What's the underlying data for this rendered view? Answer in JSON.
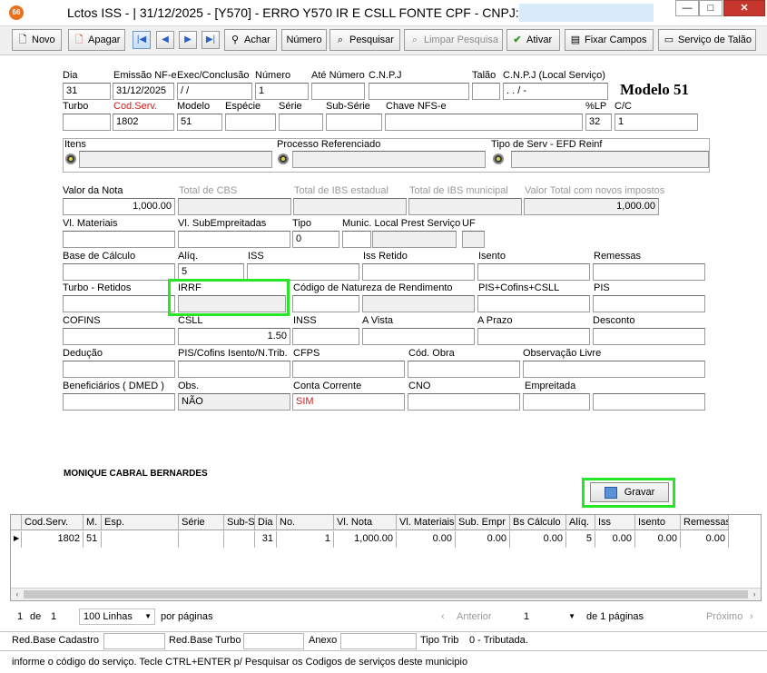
{
  "window": {
    "app_icon_text": "66",
    "title": "Lctos ISS - |  31/12/2025 - [Y570] - ERRO Y570 IR E CSLL FONTE CPF - CNPJ:",
    "cnpj_value": "",
    "minimize": "—",
    "maximize": "□",
    "close": "✕"
  },
  "toolbar": {
    "novo": "Novo",
    "apagar": "Apagar",
    "first": "|◀",
    "prev": "◀",
    "next": "▶",
    "last": "▶|",
    "achar": "Achar",
    "numero": "Número",
    "pesquisar": "Pesquisar",
    "limpar_pesquisa": "Limpar Pesquisa",
    "ativar": "Ativar",
    "fixar_campos": "Fixar Campos",
    "servico_talao": "Serviço de Talão"
  },
  "form": {
    "modelo_title": "Modelo 51",
    "dia": {
      "label": "Dia",
      "value": "31"
    },
    "emissao": {
      "label": "Emissão NF-e",
      "value": "31/12/2025"
    },
    "exec": {
      "label": "Exec/Conclusão",
      "value": " / /"
    },
    "numero": {
      "label": "Número",
      "value": "1"
    },
    "ate_numero": {
      "label": "Até Número",
      "value": ""
    },
    "cnpj": {
      "label": "C.N.P.J",
      "value": ""
    },
    "talao": {
      "label": "Talão",
      "value": ""
    },
    "cnpj_local": {
      "label": "C.N.P.J (Local Serviço)",
      "value": " .  .  /  -"
    },
    "turbo": {
      "label": "Turbo",
      "value": ""
    },
    "cod_serv": {
      "label": "Cod.Serv.",
      "value": "1802"
    },
    "modelo": {
      "label": "Modelo",
      "value": "51"
    },
    "especie": {
      "label": "Espécie",
      "value": ""
    },
    "serie": {
      "label": "Série",
      "value": ""
    },
    "sub_serie": {
      "label": "Sub-Série",
      "value": ""
    },
    "chave_nfse": {
      "label": "Chave NFS-e",
      "value": ""
    },
    "pct_lp": {
      "label": "%LP",
      "value": "32"
    },
    "cc": {
      "label": "C/C",
      "value": "1"
    },
    "itens": {
      "label": "Itens",
      "value": ""
    },
    "processo_ref": {
      "label": "Processo Referenciado",
      "value": ""
    },
    "tipo_serv": {
      "label": "Tipo de Serv - EFD Reinf",
      "value": ""
    },
    "valor_nota": {
      "label": "Valor da Nota",
      "value": "1,000.00"
    },
    "total_cbs": {
      "label": "Total de CBS",
      "value": ""
    },
    "total_ibs_est": {
      "label": "Total de IBS estadual",
      "value": ""
    },
    "total_ibs_mun": {
      "label": "Total de IBS municipal",
      "value": ""
    },
    "valor_total_novos": {
      "label": "Valor Total com novos impostos",
      "value": "1,000.00"
    },
    "vl_materiais": {
      "label": "Vl. Materiais",
      "value": ""
    },
    "vl_subempreitadas": {
      "label": "Vl. SubEmpreitadas",
      "value": ""
    },
    "tipo": {
      "label": "Tipo",
      "value": "0"
    },
    "munic": {
      "label": "Munic. Local Prest Serviço",
      "value": ""
    },
    "uf": {
      "label": "UF",
      "value": ""
    },
    "base_calculo": {
      "label": "Base de Cálculo",
      "value": ""
    },
    "aliq": {
      "label": "Alíq.",
      "value": "5"
    },
    "iss": {
      "label": "ISS",
      "value": ""
    },
    "iss_retido": {
      "label": "Iss Retido",
      "value": ""
    },
    "isento": {
      "label": "Isento",
      "value": ""
    },
    "remessas": {
      "label": "Remessas",
      "value": ""
    },
    "turbo_retidos": {
      "label": "Turbo - Retidos",
      "value": ""
    },
    "irrf": {
      "label": "IRRF",
      "value": ""
    },
    "cod_natureza": {
      "label": "Código de Natureza de Rendimento",
      "value": ""
    },
    "pis_cofins_csll": {
      "label": "PIS+Cofins+CSLL",
      "value": ""
    },
    "pis": {
      "label": "PIS",
      "value": ""
    },
    "cofins": {
      "label": "COFINS",
      "value": ""
    },
    "csll": {
      "label": "CSLL",
      "value": "1.50"
    },
    "inss": {
      "label": "INSS",
      "value": ""
    },
    "a_vista": {
      "label": "A Vista",
      "value": ""
    },
    "a_prazo": {
      "label": "A Prazo",
      "value": ""
    },
    "desconto": {
      "label": "Desconto",
      "value": ""
    },
    "deducao": {
      "label": "Dedução",
      "value": ""
    },
    "pis_cofins_isento": {
      "label": "PIS/Cofins Isento/N.Trib.",
      "value": ""
    },
    "cfps": {
      "label": "CFPS",
      "value": ""
    },
    "cod_obra": {
      "label": "Cód. Obra",
      "value": ""
    },
    "obs_livre": {
      "label": "Observação Livre",
      "value": ""
    },
    "beneficiarios": {
      "label": "Beneficiários ( DMED )",
      "value": ""
    },
    "obs": {
      "label": "Obs.",
      "value": "NÃO"
    },
    "conta_corrente": {
      "label": "Conta Corrente",
      "value": "SIM"
    },
    "cno": {
      "label": "CNO",
      "value": ""
    },
    "empreitada": {
      "label": "Empreitada",
      "value": ""
    },
    "person_name": "MONIQUE CABRAL BERNARDES",
    "gravar": "Gravar"
  },
  "grid": {
    "columns": [
      "Cod.Serv.",
      "M.",
      "Esp.",
      "Série",
      "Sub-S",
      "Dia",
      "No.",
      "Vl. Nota",
      "Vl. Materiais",
      "Sub. Empr",
      "Bs Cálculo",
      "Alíq.",
      "Iss",
      "Isento",
      "Remessas"
    ],
    "rows": [
      [
        "1802",
        "51",
        "",
        "",
        "",
        "31",
        "1",
        "1,000.00",
        "0.00",
        "0.00",
        "0.00",
        "5",
        "0.00",
        "0.00",
        "0.00"
      ]
    ]
  },
  "pager": {
    "page": "1",
    "de": "de",
    "total": "1",
    "lines": "100 Linhas",
    "per_page": "por páginas",
    "anterior": "Anterior",
    "current": "1",
    "de_paginas": "de 1 páginas",
    "proximo": "Próximo"
  },
  "status": {
    "red_base_cadastro": "Red.Base Cadastro",
    "red_base_turbo": "Red.Base Turbo",
    "anexo": "Anexo",
    "tipo_trib": "Tipo Trib",
    "tipo_trib_value": "0 - Tributada.",
    "hint": "informe o código do serviço. Tecle CTRL+ENTER p/ Pesquisar os Codigos de serviços deste municipio"
  }
}
